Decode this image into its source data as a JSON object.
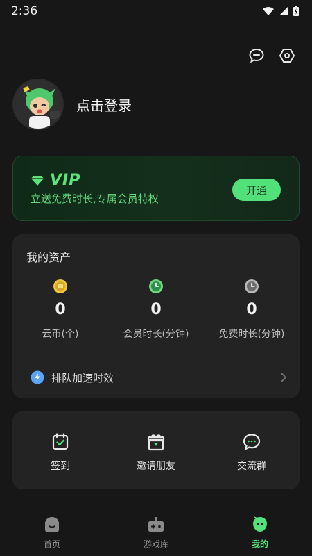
{
  "status_bar": {
    "time": "2:36"
  },
  "header": {
    "message_icon": "chat-bubble-icon",
    "settings_icon": "gear-hexagon-icon"
  },
  "profile": {
    "login_text": "点击登录"
  },
  "vip": {
    "title": "VIP",
    "subtitle": "立送免费时长,专属会员特权",
    "button_label": "开通",
    "accent_color": "#52e07a"
  },
  "assets": {
    "title": "我的资产",
    "items": [
      {
        "value": "0",
        "label": "云币(个)",
        "icon": "coin-icon"
      },
      {
        "value": "0",
        "label": "会员时长(分钟)",
        "icon": "green-clock-icon"
      },
      {
        "value": "0",
        "label": "免费时长(分钟)",
        "icon": "gray-clock-icon"
      }
    ],
    "queue_label": "排队加速时效"
  },
  "actions": [
    {
      "label": "签到",
      "icon": "calendar-check-icon"
    },
    {
      "label": "邀请朋友",
      "icon": "gift-icon"
    },
    {
      "label": "交流群",
      "icon": "chat-group-icon"
    }
  ],
  "bottom_nav": [
    {
      "label": "首页",
      "icon": "home-icon",
      "active": false
    },
    {
      "label": "游戏库",
      "icon": "gamepad-icon",
      "active": false
    },
    {
      "label": "我的",
      "icon": "profile-face-icon",
      "active": true
    }
  ]
}
